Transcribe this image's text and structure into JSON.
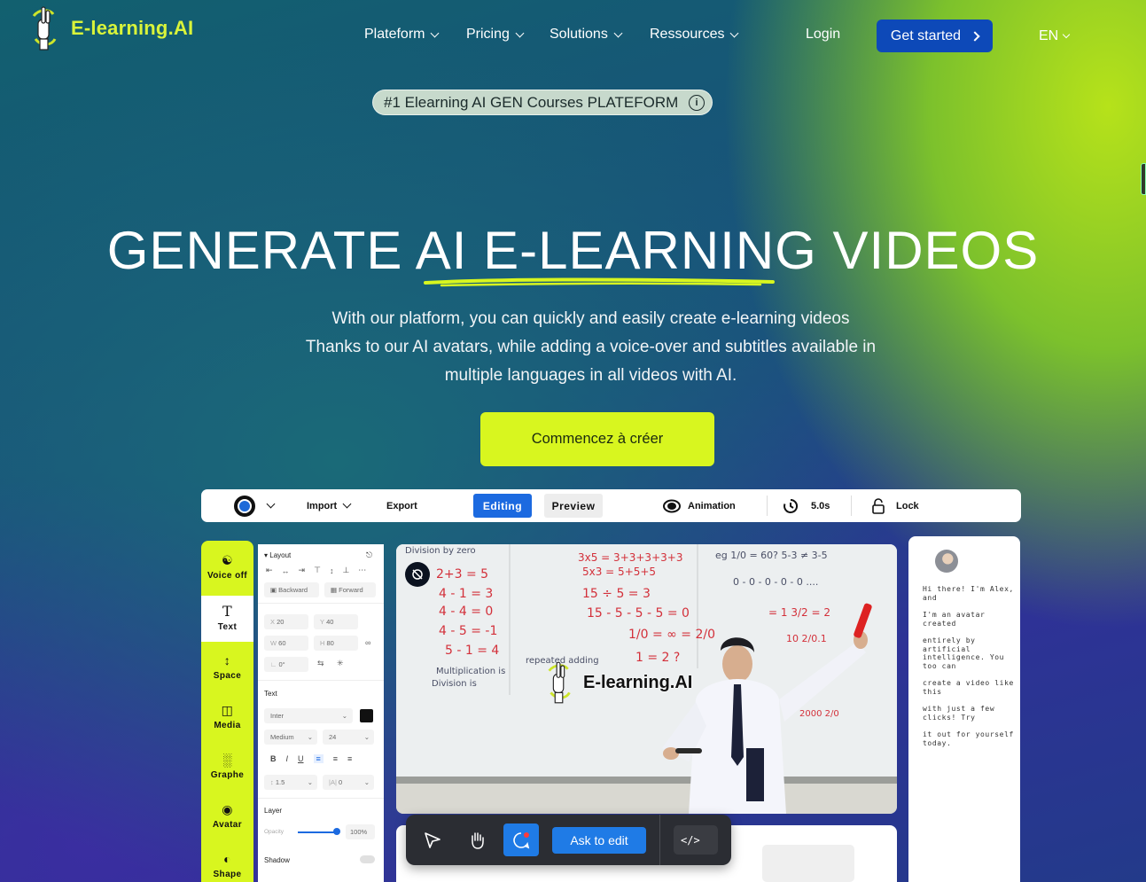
{
  "brand": {
    "name": "E-learning.AI",
    "accent": "#d8f61f",
    "primary": "#0d49b8"
  },
  "nav": {
    "items": [
      {
        "label": "Plateform"
      },
      {
        "label": "Pricing"
      },
      {
        "label": "Solutions"
      },
      {
        "label": "Ressources"
      }
    ],
    "login": "Login",
    "get_started": "Get started",
    "language": "EN"
  },
  "hero": {
    "badge": "#1 Elearning AI GEN Courses PLATEFORM",
    "title": "GENERATE AI E-LEARNING VIDEOS",
    "subtitle_lines": [
      "With our platform, you can quickly and easily create e-learning videos",
      "Thanks to our AI avatars, while adding a voice-over and subtitles available in",
      "multiple languages in all videos with AI."
    ],
    "cta": "Commencez à créer"
  },
  "editor": {
    "toolbar": {
      "import": "Import",
      "export": "Export",
      "editing": "Editing",
      "preview": "Preview",
      "animation": "Animation",
      "duration": "5.0s",
      "lock": "Lock"
    },
    "sidebar": [
      {
        "label": "Voice off",
        "icon": "voice-icon"
      },
      {
        "label": "Text",
        "icon": "text-icon"
      },
      {
        "label": "Space",
        "icon": "space-icon"
      },
      {
        "label": "Media",
        "icon": "media-icon"
      },
      {
        "label": "Graphe",
        "icon": "graph-icon"
      },
      {
        "label": "Avatar",
        "icon": "avatar-icon"
      },
      {
        "label": "Shape",
        "icon": "shape-icon"
      }
    ],
    "panel": {
      "layout_title": "Layout",
      "backward": "Backward",
      "forward": "Forward",
      "x": "20",
      "y": "40",
      "w": "60",
      "h": "80",
      "rotation": "0°",
      "text_title": "Text",
      "font": "Inter",
      "weight": "Medium",
      "size": "24",
      "line_height": "1.5",
      "letter_spacing": "0",
      "layer_title": "Layer",
      "opacity_label": "Opacity",
      "opacity_value": "100%",
      "shadow_label": "Shadow"
    },
    "video_logo": "E-learning.AI",
    "chat_lines": [
      "Hi there! I'm Alex, and",
      "I'm an avatar created",
      "entirely by artificial",
      "intelligence. You too can",
      "create a video like this",
      "with just a few clicks! Try",
      "it out for yourself today."
    ],
    "bottom_bar": {
      "ask_to_edit": "Ask to edit",
      "code": "</>"
    }
  }
}
